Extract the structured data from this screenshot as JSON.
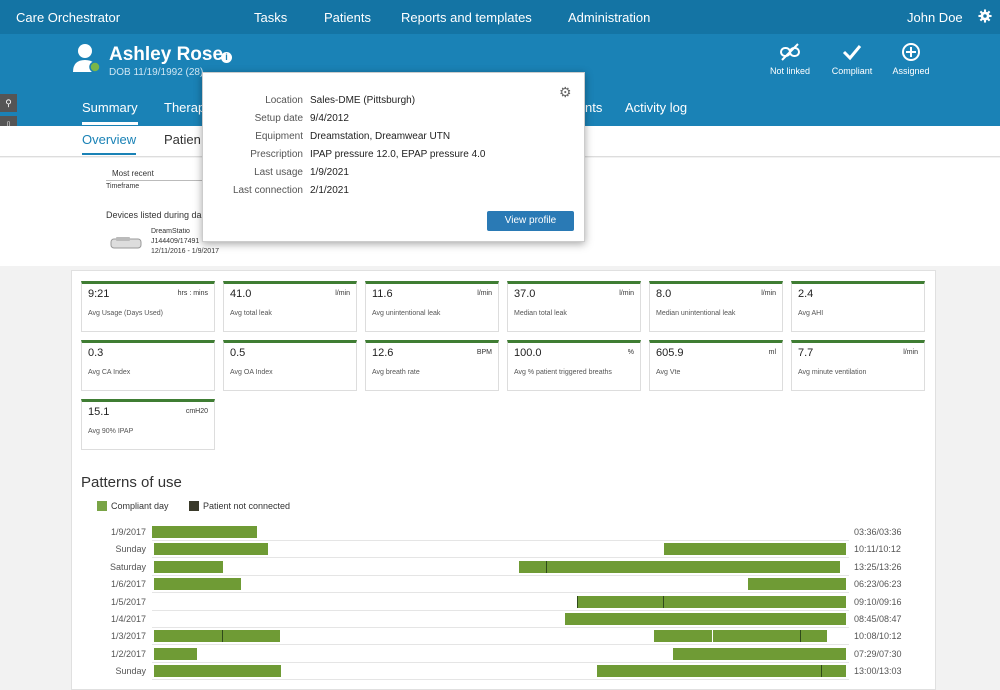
{
  "topnav": {
    "app_title": "Care Orchestrator",
    "items": [
      "Tasks",
      "Patients",
      "Reports and templates",
      "Administration"
    ],
    "user": "John Doe",
    "settings_icon": "gear-icon"
  },
  "patient": {
    "name": "Ashley Rose",
    "dob_line": "DOB 11/19/1992 (28)"
  },
  "status_icons": [
    {
      "label": "Not linked",
      "icon": "unlinked-icon"
    },
    {
      "label": "Compliant",
      "icon": "check-icon"
    },
    {
      "label": "Assigned",
      "icon": "plus-circle-icon"
    }
  ],
  "tabs": [
    "Summary",
    "Therapy",
    "Activity log",
    "nts"
  ],
  "subtabs": [
    "Overview",
    "Patien"
  ],
  "overview": {
    "most_recent": "Most recent",
    "timeframe": "Timeframe",
    "devices_heading": "Devices listed during da",
    "device_name": "DreamStatio",
    "device_serial": "J144409/17491",
    "device_dates": "12/11/2016 - 1/9/2017"
  },
  "popup": {
    "rows": [
      {
        "key": "Location",
        "value": "Sales-DME (Pittsburgh)"
      },
      {
        "key": "Setup date",
        "value": "9/4/2012"
      },
      {
        "key": "Equipment",
        "value": "Dreamstation, Dreamwear UTN"
      },
      {
        "key": "Prescription",
        "value": "IPAP pressure 12.0, EPAP pressure 4.0"
      },
      {
        "key": "Last usage",
        "value": "1/9/2021"
      },
      {
        "key": "Last connection",
        "value": "2/1/2021"
      }
    ],
    "button": "View profile"
  },
  "metrics": [
    {
      "value": "9:21",
      "unit": "hrs : mins",
      "label": "Avg Usage (Days Used)"
    },
    {
      "value": "41.0",
      "unit": "l/min",
      "label": "Avg total leak"
    },
    {
      "value": "11.6",
      "unit": "l/min",
      "label": "Avg unintentional leak"
    },
    {
      "value": "37.0",
      "unit": "l/min",
      "label": "Median total leak"
    },
    {
      "value": "8.0",
      "unit": "l/min",
      "label": "Median unintentional leak"
    },
    {
      "value": "2.4",
      "unit": "",
      "label": "Avg AHI"
    },
    {
      "value": "0.3",
      "unit": "",
      "label": "Avg CA Index"
    },
    {
      "value": "0.5",
      "unit": "",
      "label": "Avg OA Index"
    },
    {
      "value": "12.6",
      "unit": "BPM",
      "label": "Avg breath rate"
    },
    {
      "value": "100.0",
      "unit": "%",
      "label": "Avg % patient triggered breaths"
    },
    {
      "value": "605.9",
      "unit": "ml",
      "label": "Avg Vte"
    },
    {
      "value": "7.7",
      "unit": "l/min",
      "label": "Avg minute ventilation"
    },
    {
      "value": "15.1",
      "unit": "cmH20",
      "label": "Avg 90% IPAP"
    }
  ],
  "patterns": {
    "title": "Patterns of use",
    "legend": [
      {
        "label": "Compliant day",
        "color": "#79a446"
      },
      {
        "label": "Patient not connected",
        "color": "#3a3a2a"
      }
    ],
    "rows": [
      {
        "label": "1/9/2017",
        "time": "03:36/03:36",
        "bars": [
          [
            0,
            0.15
          ]
        ],
        "ticks": []
      },
      {
        "label": "Sunday",
        "time": "10:11/10:12",
        "bars": [
          [
            0.003,
            0.167
          ],
          [
            0.735,
            0.995
          ]
        ],
        "ticks": []
      },
      {
        "label": "Saturday",
        "time": "13:25/13:26",
        "bars": [
          [
            0.003,
            0.102
          ],
          [
            0.527,
            0.987
          ]
        ],
        "ticks": [
          0.565
        ]
      },
      {
        "label": "1/6/2017",
        "time": "06:23/06:23",
        "bars": [
          [
            0.003,
            0.127
          ],
          [
            0.855,
            0.995
          ]
        ],
        "ticks": []
      },
      {
        "label": "1/5/2017",
        "time": "09:10/09:16",
        "bars": [
          [
            0.61,
            0.995
          ]
        ],
        "ticks": [
          0.61,
          0.733
        ]
      },
      {
        "label": "1/4/2017",
        "time": "08:45/08:47",
        "bars": [
          [
            0.592,
            0.995
          ]
        ],
        "ticks": []
      },
      {
        "label": "1/3/2017",
        "time": "10:08/10:12",
        "bars": [
          [
            0.003,
            0.183
          ],
          [
            0.72,
            0.803
          ],
          [
            0.805,
            0.968
          ]
        ],
        "ticks": [
          0.1,
          0.93
        ]
      },
      {
        "label": "1/2/2017",
        "time": "07:29/07:30",
        "bars": [
          [
            0.003,
            0.064
          ],
          [
            0.747,
            0.995
          ]
        ],
        "ticks": []
      },
      {
        "label": "Sunday",
        "time": "13:00/13:03",
        "bars": [
          [
            0.003,
            0.185
          ],
          [
            0.638,
            0.995
          ]
        ],
        "ticks": [
          0.96
        ]
      }
    ]
  }
}
